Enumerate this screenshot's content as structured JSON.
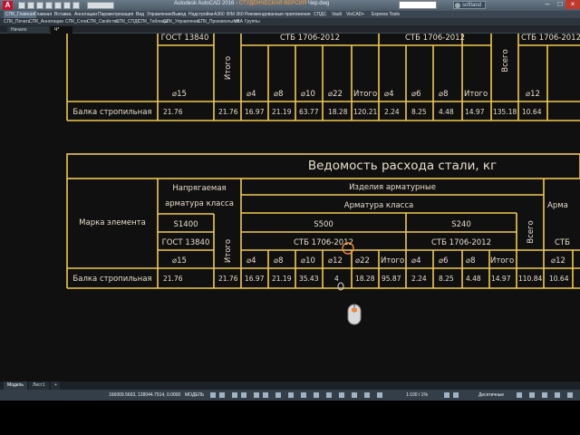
{
  "window": {
    "title_prefix": "Autodesk AutoCAD 2016 - ",
    "title_highlight": "СТУДЕНЧЕСКАЯ ВЕРСИЯ",
    "title_suffix": "  Чер.dwg",
    "user": "softland"
  },
  "menu": [
    "СПК_Главная",
    "Главная",
    "Вставка",
    "Аннотации",
    "Параметризация",
    "Вид",
    "Управление",
    "Вывод",
    "Надстройки",
    "А360",
    "BIM 360",
    "Рекомендованные приложения",
    "СПДС",
    "Vault",
    "VisCAD+",
    "Express Tools"
  ],
  "ribbon_panels": [
    "СПК_Печать",
    "СПК_Аннотации",
    "СПК_Слои",
    "СПК_Свойства",
    "СПК_СПДС",
    "СПК_Таблицы",
    "СПК_Управление",
    "СПК_Произвольное",
    "VBA",
    "Группы"
  ],
  "doc_tabs": {
    "start": "Начало",
    "active": "Ч*"
  },
  "top_table": {
    "row_gost": [
      "ГОСТ 13840",
      "",
      "",
      "СТБ 1706-2012",
      "",
      "",
      "СТБ 1706-2012",
      "",
      "",
      "СТБ 1706-2012"
    ],
    "total_vert": "Итого",
    "total_vert2": "Всего",
    "sizes": [
      "⌀15",
      "⌀4",
      "⌀8",
      "⌀10",
      "⌀22",
      "Итого",
      "⌀4",
      "⌀6",
      "⌀8",
      "Итого",
      "⌀12"
    ],
    "row_name": "Балка стропильная",
    "values": [
      "21.76",
      "21.76",
      "16.97",
      "21.19",
      "63.77",
      "18.28",
      "120.21",
      "2.24",
      "8.25",
      "4.48",
      "14.97",
      "135.18",
      "10.64"
    ]
  },
  "main_table": {
    "title": "Ведомость расхода стали, кг",
    "mark_label": "Марка элемента",
    "prestressed": [
      "Напрягаемая",
      "арматура класса"
    ],
    "products": "Изделия арматурные",
    "rebar_class": "Арматура класса",
    "cut_right": "Арма",
    "s1400": "S1400",
    "s500": "S500",
    "s240": "S240",
    "gost": "ГОСТ 13840",
    "stb1": "СТБ 1706-2012",
    "stb2": "СТБ 1706-2012",
    "stb3": "СТБ",
    "total_vert": "Итого",
    "all_vert": "Всего",
    "sizes": [
      "⌀15",
      "⌀4",
      "⌀8",
      "⌀10",
      "⌀12",
      "⌀22",
      "Итого",
      "⌀4",
      "⌀6",
      "⌀8",
      "Итого",
      "⌀12"
    ],
    "row_name": "Балка стропильная",
    "values": [
      "21.76",
      "21.76",
      "16.97",
      "21.19",
      "35.43",
      "4",
      "18.28",
      "95.87",
      "2.24",
      "8.25",
      "4.48",
      "14.97",
      "110.84",
      "10.64"
    ]
  },
  "layout_tabs": [
    "Модель",
    "Лист1",
    "+"
  ],
  "status": {
    "coords": "166069.5603, 128044.7514, 0.0000",
    "mode": "МОДЕЛЬ",
    "scale": "1:100 / 1%",
    "units": "Десятичные"
  }
}
